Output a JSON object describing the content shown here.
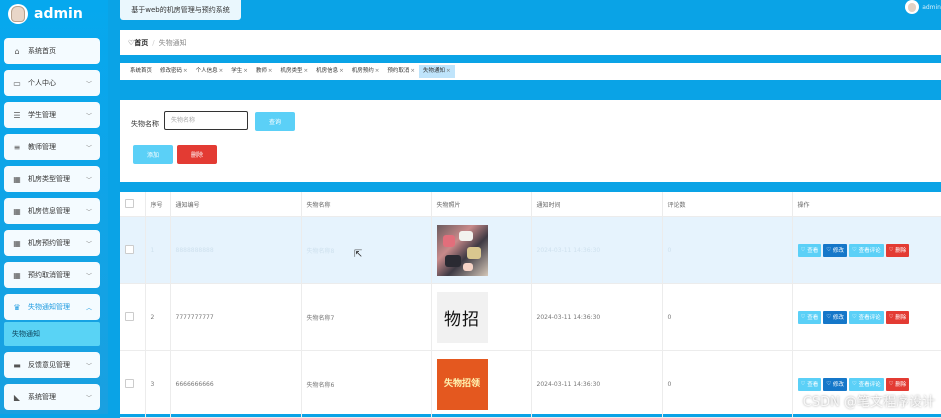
{
  "brand": {
    "name": "admin"
  },
  "topbar": {
    "title": "基于web的机房管理与预约系统"
  },
  "user": {
    "name": "admin"
  },
  "sidebar": {
    "items": [
      {
        "label": "系统首页",
        "icon": "home-icon"
      },
      {
        "label": "个人中心",
        "icon": "profile-card-icon"
      },
      {
        "label": "学生管理",
        "icon": "sliders-icon"
      },
      {
        "label": "教师管理",
        "icon": "list-icon"
      },
      {
        "label": "机房类型管理",
        "icon": "grid-icon"
      },
      {
        "label": "机房信息管理",
        "icon": "grid-icon"
      },
      {
        "label": "机房预约管理",
        "icon": "grid-icon"
      },
      {
        "label": "预约取消管理",
        "icon": "grid-icon"
      },
      {
        "label": "失物通知管理",
        "icon": "gift-icon"
      },
      {
        "label": "反馈意见管理",
        "icon": "monitor-icon"
      },
      {
        "label": "系统管理",
        "icon": "thumb-icon"
      }
    ],
    "subitem": "失物通知"
  },
  "breadcrumb": {
    "home": "首页",
    "current": "失物通知"
  },
  "tags": [
    "系统首页",
    "修改密码",
    "个人信息",
    "学生",
    "教师",
    "机房类型",
    "机房信息",
    "机房预约",
    "预约取消",
    "失物通知"
  ],
  "search": {
    "label": "失物名称",
    "placeholder": "失物名称",
    "query_label": "查询",
    "add_label": "添加",
    "delete_label": "删除"
  },
  "table": {
    "headers": [
      "",
      "序号",
      "通知编号",
      "失物名称",
      "失物照片",
      "通知时间",
      "评论数",
      "操作"
    ],
    "rows": [
      {
        "index": "1",
        "code": "8888888888",
        "name": "失物名称8",
        "time": "2024-03-11 14:36:30",
        "comments": "0"
      },
      {
        "index": "2",
        "code": "7777777777",
        "name": "失物名称7",
        "time": "2024-03-11 14:36:30",
        "comments": "0",
        "photo_text": "物招"
      },
      {
        "index": "3",
        "code": "6666666666",
        "name": "失物名称6",
        "time": "2024-03-11 14:36:30",
        "comments": "0",
        "photo_text": "失物招领"
      }
    ],
    "actions": {
      "view": "查看",
      "edit": "修改",
      "review": "查看评论",
      "delete": "删除"
    }
  },
  "watermark": "CSDN @笔文程序设计",
  "colors": {
    "primary": "#0aa3e6",
    "accent": "#5bd0f7",
    "danger": "#e33b33",
    "edit": "#1577c9"
  }
}
